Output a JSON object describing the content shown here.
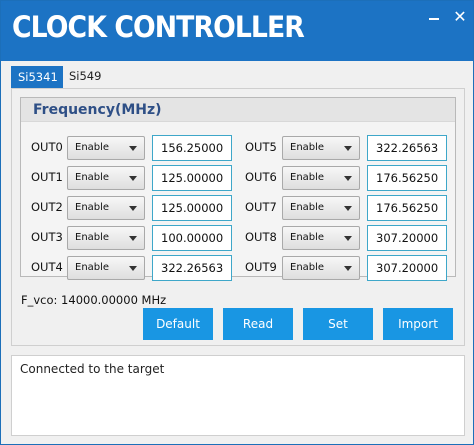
{
  "app": {
    "title": "CLOCK CONTROLLER",
    "close_glyph": "✕"
  },
  "tabs": [
    {
      "label": "Si5341",
      "active": true
    },
    {
      "label": "Si549",
      "active": false
    }
  ],
  "frequency_group": {
    "title": "Frequency(MHz)",
    "outputs": [
      {
        "label": "OUT0",
        "mode": "Enable",
        "value": "156.25000"
      },
      {
        "label": "OUT1",
        "mode": "Enable",
        "value": "125.00000"
      },
      {
        "label": "OUT2",
        "mode": "Enable",
        "value": "125.00000"
      },
      {
        "label": "OUT3",
        "mode": "Enable",
        "value": "100.00000"
      },
      {
        "label": "OUT4",
        "mode": "Enable",
        "value": "322.26563"
      },
      {
        "label": "OUT5",
        "mode": "Enable",
        "value": "322.26563"
      },
      {
        "label": "OUT6",
        "mode": "Enable",
        "value": "176.56250"
      },
      {
        "label": "OUT7",
        "mode": "Enable",
        "value": "176.56250"
      },
      {
        "label": "OUT8",
        "mode": "Enable",
        "value": "307.20000"
      },
      {
        "label": "OUT9",
        "mode": "Enable",
        "value": "307.20000"
      }
    ]
  },
  "fvco": "F_vco: 14000.00000 MHz",
  "buttons": {
    "default": "Default",
    "read": "Read",
    "set": "Set",
    "import": "Import"
  },
  "status": {
    "message": "Connected to the target"
  },
  "colors": {
    "title_bar": "#1c73c4",
    "button": "#1996e3",
    "group_title": "#2e4f86",
    "input_border": "#3ea7c9"
  }
}
